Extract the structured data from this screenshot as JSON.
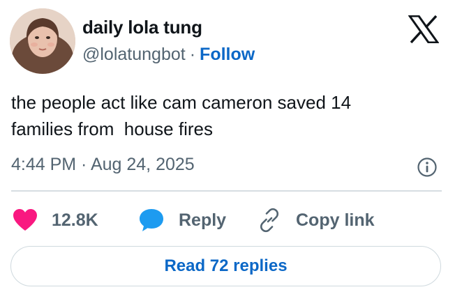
{
  "author": {
    "display_name": "daily lola tung",
    "handle": "@lolatungbot",
    "separator": "·",
    "follow_label": "Follow",
    "avatar_icon": "profile-photo"
  },
  "tweet": {
    "text": "the people act like cam cameron saved 14\nfamilies from  house fires",
    "timestamp": "4:44 PM · Aug 24, 2025"
  },
  "actions": {
    "likes_count": "12.8K",
    "reply_label": "Reply",
    "copy_link_label": "Copy link"
  },
  "footer": {
    "read_replies_label": "Read 72 replies"
  },
  "colors": {
    "link_blue": "#0c68c7",
    "like_pink": "#f91880",
    "reply_blue": "#1d9bf0",
    "text_primary": "#0f1419",
    "text_secondary": "#536471",
    "divider": "#d6dde2"
  },
  "icons": {
    "logo": "x-logo-icon",
    "info": "info-icon",
    "like": "heart-icon",
    "reply": "speech-bubble-icon",
    "copy": "link-icon"
  }
}
